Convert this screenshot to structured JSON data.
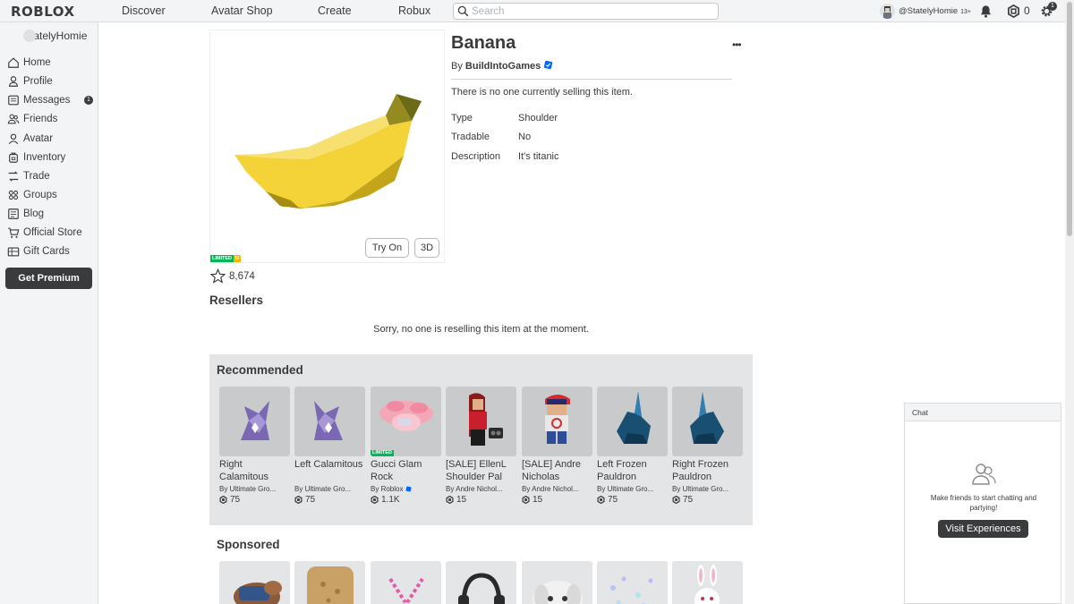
{
  "header": {
    "logo": "ROBLOX",
    "nav": [
      "Discover",
      "Avatar Shop",
      "Create",
      "Robux"
    ],
    "search_placeholder": "Search",
    "username": "@StatelyHomie",
    "age_badge": "13+",
    "robux": "0",
    "settings_badge": "1"
  },
  "sidebar": {
    "user": "StatelyHomie",
    "items": [
      {
        "label": "Home",
        "icon": "home-icon"
      },
      {
        "label": "Profile",
        "icon": "profile-icon"
      },
      {
        "label": "Messages",
        "icon": "messages-icon",
        "badge": "1"
      },
      {
        "label": "Friends",
        "icon": "friends-icon"
      },
      {
        "label": "Avatar",
        "icon": "avatar-icon"
      },
      {
        "label": "Inventory",
        "icon": "inventory-icon"
      },
      {
        "label": "Trade",
        "icon": "trade-icon"
      },
      {
        "label": "Groups",
        "icon": "groups-icon"
      },
      {
        "label": "Blog",
        "icon": "blog-icon"
      },
      {
        "label": "Official Store",
        "icon": "store-icon"
      },
      {
        "label": "Gift Cards",
        "icon": "gift-card-icon"
      }
    ],
    "premium_label": "Get Premium"
  },
  "item": {
    "name": "Banana",
    "by_label": "By",
    "creator": "BuildIntoGames",
    "selling_status": "There is no one currently selling this item.",
    "fields": [
      {
        "label": "Type",
        "value": "Shoulder"
      },
      {
        "label": "Tradable",
        "value": "No"
      },
      {
        "label": "Description",
        "value": "It's titanic"
      }
    ],
    "try_on_label": "Try On",
    "view3d_label": "3D",
    "limited_label": "LIMITED",
    "limited_u_label": "U",
    "favorites": "8,674"
  },
  "resellers": {
    "heading": "Resellers",
    "message": "Sorry, no one is reselling this item at the moment."
  },
  "recommended": {
    "heading": "Recommended",
    "items": [
      {
        "name": "Right Calamitous",
        "creator": "Ultimate Gro...",
        "price": "75",
        "limited": false
      },
      {
        "name": "Left Calamitous",
        "creator": "Ultimate Gro...",
        "price": "75",
        "limited": false
      },
      {
        "name": "Gucci Glam Rock",
        "creator": "Roblox",
        "price": "1.1K",
        "limited": true
      },
      {
        "name": "[SALE] EllenL Shoulder Pal",
        "creator": "Andre Nichol...",
        "price": "15",
        "limited": false
      },
      {
        "name": "[SALE] Andre Nicholas",
        "creator": "Andre Nichol...",
        "price": "15",
        "limited": false
      },
      {
        "name": "Left Frozen Pauldron",
        "creator": "Ultimate Gro...",
        "price": "75",
        "limited": false
      },
      {
        "name": "Right Frozen Pauldron",
        "creator": "Ultimate Gro...",
        "price": "75",
        "limited": false
      }
    ],
    "by_label": "By",
    "limited_label": "LIMITED"
  },
  "sponsored": {
    "heading": "Sponsored"
  },
  "chat": {
    "title": "Chat",
    "message": "Make friends to start chatting and partying!",
    "button": "Visit Experiences"
  },
  "colors": {
    "accent_dark": "#393b3d",
    "limited_green": "#02b757",
    "limited_u_yellow": "#f6b702",
    "verified_blue": "#0066ff",
    "banana_yellow": "#f2cf2e"
  }
}
